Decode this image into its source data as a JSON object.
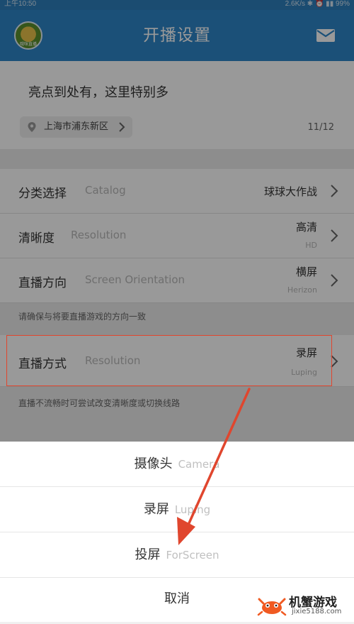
{
  "status_bar": {
    "time": "上午10:50",
    "right": "2.6K/s ✱ ⏰ ▮▮ 99%"
  },
  "navbar": {
    "title": "开播设置",
    "avatar_text": "哦咪直播"
  },
  "topic": {
    "text": "亮点到处有，这里特别多",
    "location": "上海市浦东新区",
    "counter": "11/12"
  },
  "settings": [
    {
      "label": "分类选择",
      "en": "Catalog",
      "value": "球球大作战",
      "sub": ""
    },
    {
      "label": "清晰度",
      "en": "Resolution",
      "value": "高清",
      "sub": "HD"
    },
    {
      "label": "直播方向",
      "en": "Screen Orientation",
      "value": "横屏",
      "sub": "Herizon"
    }
  ],
  "note1": "请确保与将要直播游戏的方向一致",
  "mode_row": {
    "label": "直播方式",
    "en": "Resolution",
    "value": "录屏",
    "sub": "Luping"
  },
  "note2": "直播不流畅时可尝试改变清晰度或切换线路",
  "sheet": [
    {
      "label": "摄像头",
      "en": "Camera"
    },
    {
      "label": "录屏",
      "en": "Luping"
    },
    {
      "label": "投屏",
      "en": "ForScreen"
    }
  ],
  "cancel": "取消",
  "watermark": {
    "name": "机蟹游戏",
    "url": "jixie5188.com"
  },
  "colors": {
    "nav": "#2d86c8",
    "highlight": "#e0462e"
  }
}
